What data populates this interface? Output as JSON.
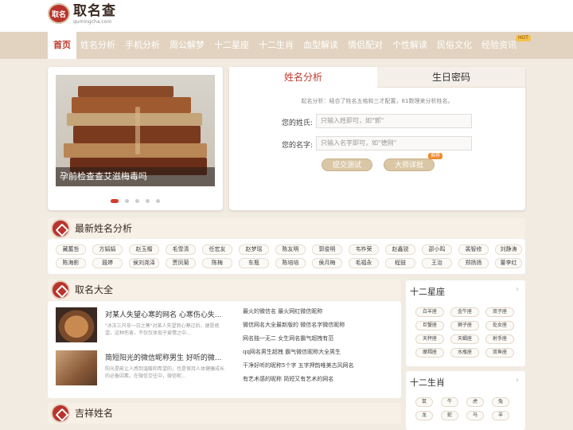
{
  "header": {
    "logo_mark": "取名",
    "logo_cn": "取名查",
    "logo_en": "qumingcha.com"
  },
  "nav": {
    "items": [
      "首页",
      "姓名分析",
      "手机分析",
      "周公解梦",
      "十二星座",
      "十二生肖",
      "血型解读",
      "情侣配对",
      "个性解读",
      "民俗文化",
      "经验资讯"
    ],
    "active": 0,
    "hot_label": "HOT"
  },
  "slider": {
    "caption": "孕前检查查艾滋梅毒吗",
    "slide_count": 5,
    "active_slide": 0
  },
  "name_form": {
    "tabs": [
      "姓名分析",
      "生日密码"
    ],
    "description": "起名分析：结合了姓名五格和三才配置，81数理来分析姓名。",
    "surname_label": "您的姓氏:",
    "surname_placeholder": "只输入姓即可，如\"郭\"",
    "given_label": "您的名字:",
    "given_placeholder": "只输入名字即可，如\"德刚\"",
    "submit_label": "提交测试",
    "master_label": "大师详批",
    "master_badge": "推荐"
  },
  "latest_names": {
    "title": "最新姓名分析",
    "row1": [
      "藏蓄哲",
      "方娟娟",
      "赵玉榴",
      "毛雪清",
      "任宏友",
      "赵梦瑶",
      "陈友明",
      "郭俊明",
      "韦祚荣",
      "赵鑫锐",
      "邵小鸣",
      "裴智修",
      "刘静涛"
    ],
    "row2": [
      "陈海影",
      "聂婷",
      "侯刘尧泽",
      "贾凤菊",
      "陈梅",
      "车瓶",
      "陈培培",
      "侯月梅",
      "毛福永",
      "程鼓",
      "王治",
      "郑扬扬",
      "董李红"
    ]
  },
  "naming": {
    "title": "取名大全",
    "articles": [
      {
        "title": "对某人失望心寒的网名 心寒伤心失...",
        "desc": "\"冰冻三尺非一日之寒\"对某人失望到心寒过后，便是绝望。这种伤害，不仅仅体现于爱情之中..."
      },
      {
        "title": "简短阳光的微信昵称男生 好听的微...",
        "desc": "阳光是能让人感到温暖和希望的，也是保持人体健康成长的必备因素。在微信交往中，微信昵..."
      }
    ],
    "links": [
      "最火的微信名 最火网红微信昵称",
      "微信网名大全最新版的 微信名字微信昵称",
      "网名独一无二 女生网名霸气超拽有范",
      "qq网名男生超拽 霸气微信昵称大全男生",
      "干净好听的昵称5个字 五字押韵唯美古风网名",
      "有艺术感的昵称 简短又有艺术的网名"
    ]
  },
  "zodiac": {
    "title": "十二星座",
    "items": [
      "白羊座",
      "金牛座",
      "双子座",
      "巨蟹座",
      "狮子座",
      "处女座",
      "天秤座",
      "天蝎座",
      "射手座",
      "摩羯座",
      "水瓶座",
      "双鱼座"
    ]
  },
  "shengxiao": {
    "title": "十二生肖",
    "items": [
      "鼠",
      "牛",
      "虎",
      "兔",
      "龙",
      "蛇",
      "马",
      "羊"
    ]
  },
  "lucky": {
    "title": "吉祥姓名"
  },
  "colors": {
    "brand_red": "#c0392b",
    "nav_bg": "#e2d3c0",
    "page_bg": "#f1ebe2"
  }
}
